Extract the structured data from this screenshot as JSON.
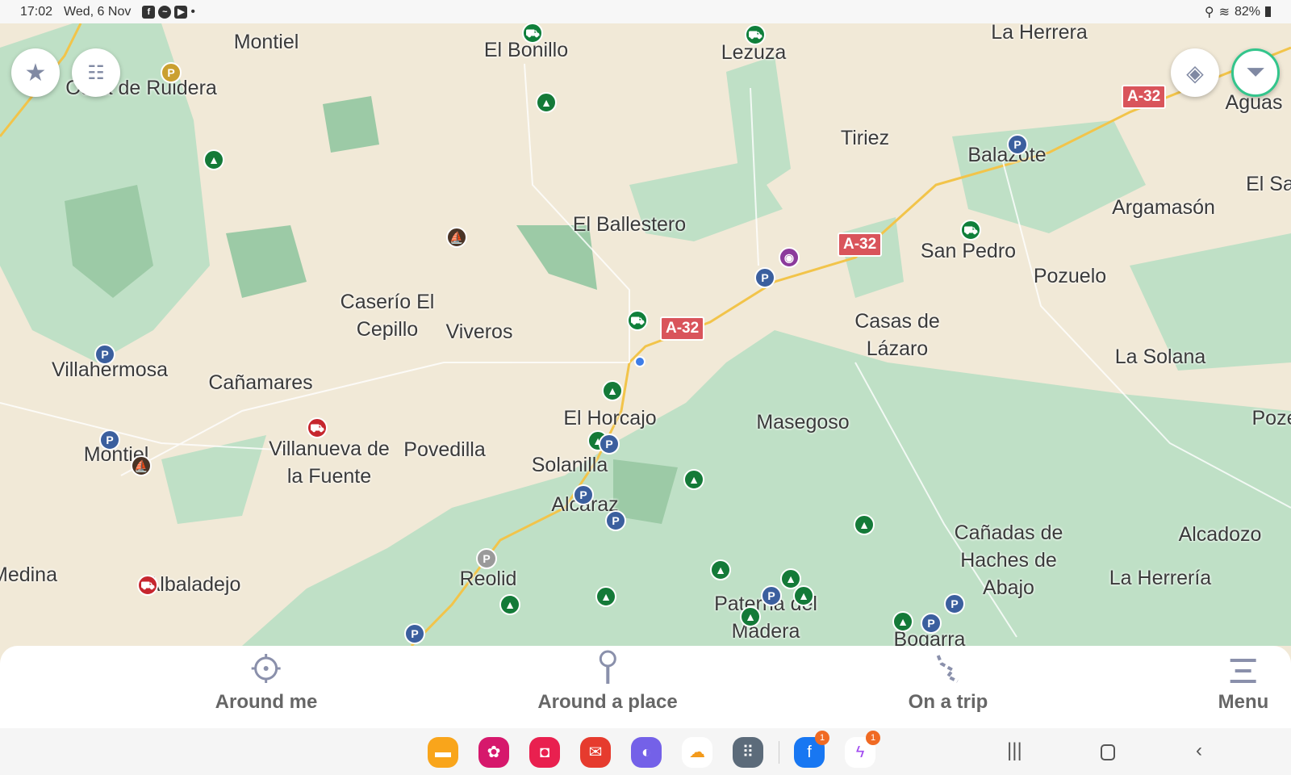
{
  "status": {
    "time": "17:02",
    "date": "Wed, 6 Nov",
    "battery": "82%",
    "notification_icons": [
      "facebook-icon",
      "messenger-icon",
      "youtube-icon"
    ]
  },
  "map": {
    "places": [
      "Montiel",
      "El Bonillo",
      "Lezuza",
      "La Herrera",
      "Ossa de Ruidera",
      "Tiriez",
      "Balazote",
      "Aguas",
      "El Sa",
      "Argamasón",
      "El Ballestero",
      "San Pedro",
      "Pozuelo",
      "Caserío El Cepillo",
      "Viveros",
      "Casas de Lázaro",
      "La Solana",
      "Villahermosa",
      "Cañamares",
      "El Horcajo",
      "Masegoso",
      "Poze",
      "Montiel",
      "Villanueva de la Fuente",
      "Povedilla",
      "Solanilla",
      "Alcaraz",
      "Cañadas de Haches de Abajo",
      "Alcadozo",
      "Medina",
      "Albaladejo",
      "Reolid",
      "La Herrería",
      "Paterna del Madera",
      "Bogarra"
    ],
    "road_labels": [
      "A-32",
      "A-32",
      "A-32"
    ],
    "parking_label": "P"
  },
  "bottom_nav": [
    {
      "label": "Around me",
      "icon": "crosshair-icon"
    },
    {
      "label": "Around a place",
      "icon": "pin-icon"
    },
    {
      "label": "On a trip",
      "icon": "route-icon"
    },
    {
      "label": "Menu",
      "icon": "menu-icon"
    }
  ],
  "dock": {
    "badges": [
      "1",
      "1"
    ]
  }
}
